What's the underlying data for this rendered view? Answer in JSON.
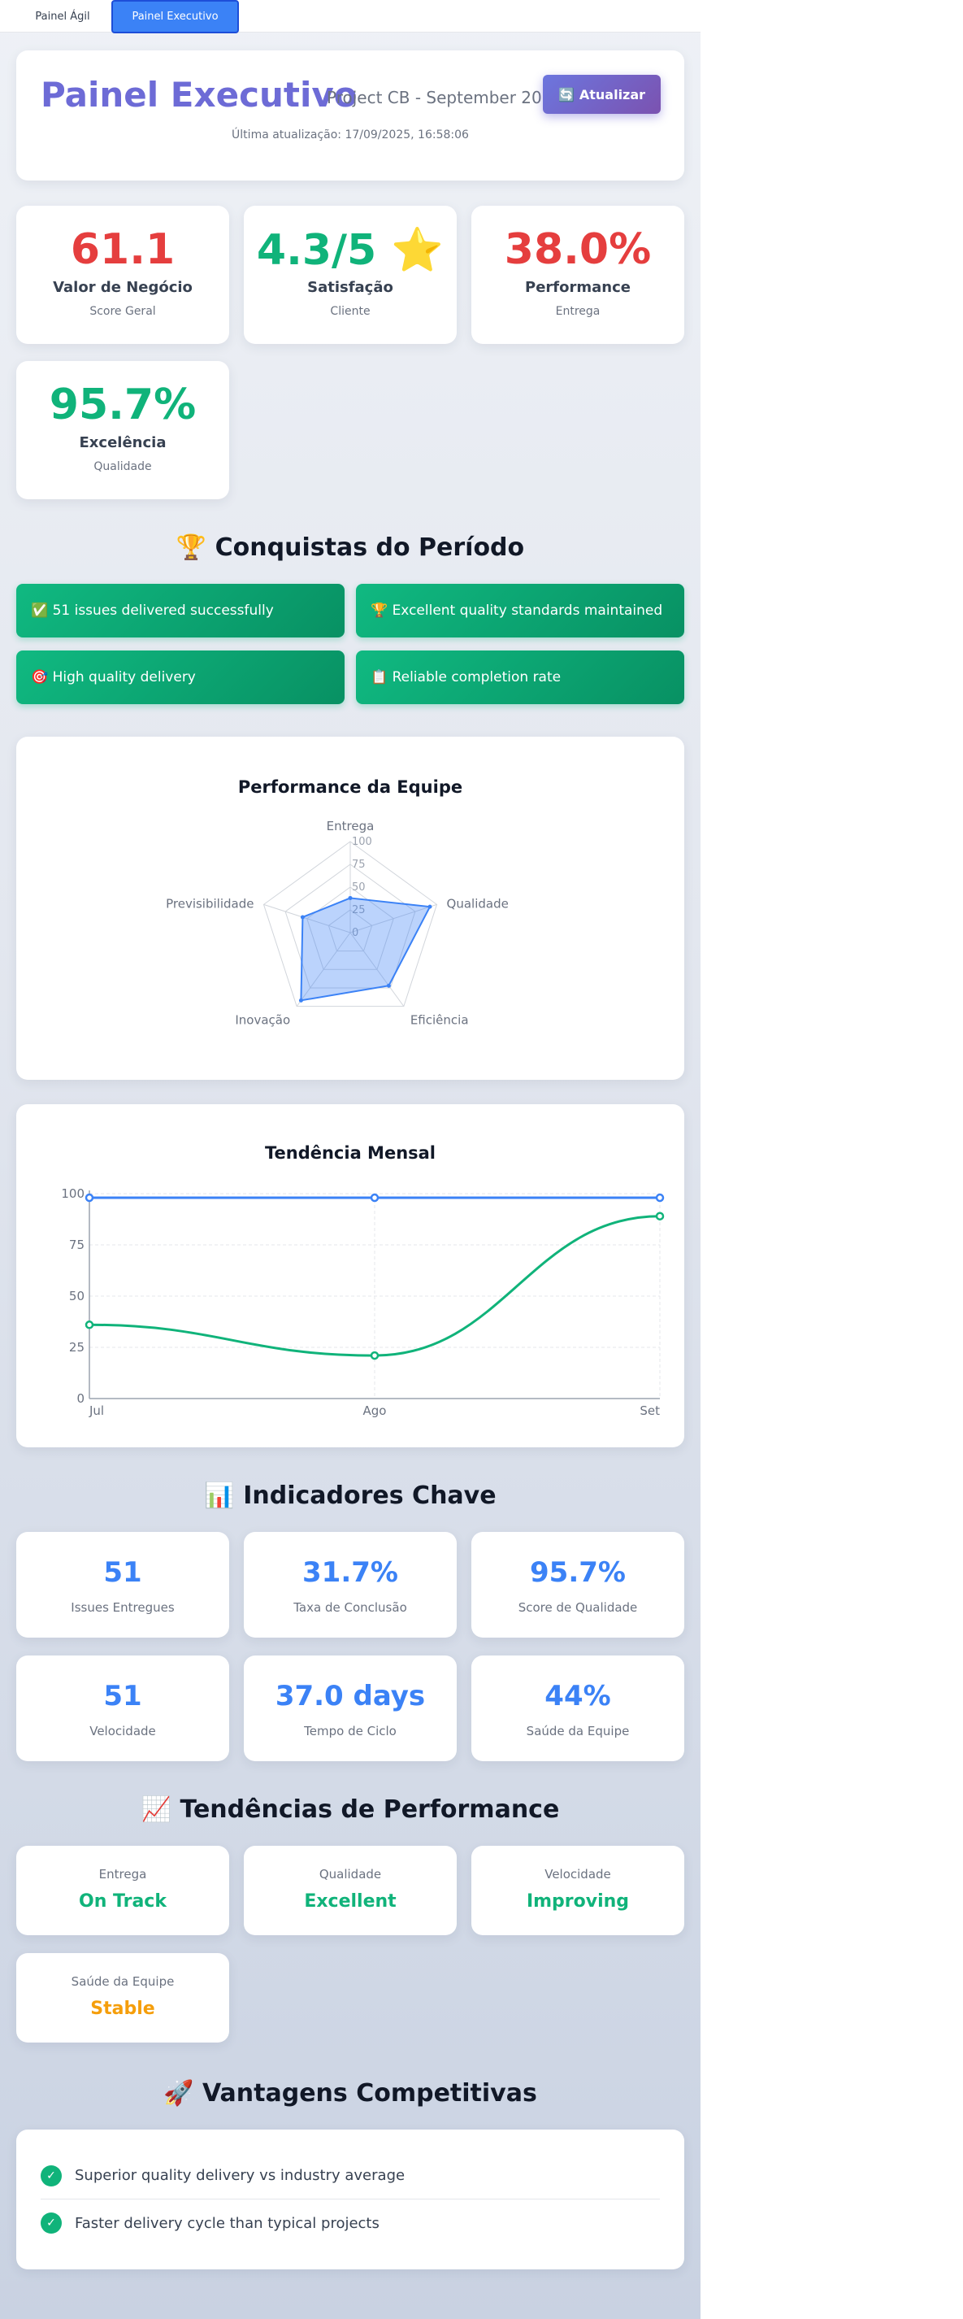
{
  "tabs": [
    {
      "label": "Painel Ágil"
    },
    {
      "label": "Painel Executivo"
    }
  ],
  "header": {
    "title": "Painel Executivo",
    "subtitle": "Project CB - September 2025",
    "refresh_icon": "🔄",
    "refresh_label": "Atualizar",
    "updated": "Última atualização: 17/09/2025, 16:58:06"
  },
  "kpis": [
    {
      "value": "61.1",
      "label": "Valor de Negócio",
      "sub": "Score Geral",
      "color": "#e53e3e"
    },
    {
      "value": "4.3/5 ⭐",
      "label": "Satisfação",
      "sub": "Cliente",
      "color": "#10b37a"
    },
    {
      "value": "38.0%",
      "label": "Performance",
      "sub": "Entrega",
      "color": "#e53e3e"
    },
    {
      "value": "95.7%",
      "label": "Excelência",
      "sub": "Qualidade",
      "color": "#10b37a"
    }
  ],
  "achievements": {
    "title": "🏆 Conquistas do Período",
    "items": [
      "✅ 51 issues delivered successfully",
      "🏆 Excellent quality standards maintained",
      "🎯 High quality delivery",
      "📋 Reliable completion rate"
    ]
  },
  "radar": {
    "title": "Performance da Equipe",
    "axes": [
      "Entrega",
      "Qualidade",
      "Eficiência",
      "Inovação",
      "Previsibilidade"
    ],
    "ticks": [
      "0",
      "25",
      "50",
      "75",
      "100"
    ]
  },
  "trend_chart": {
    "title": "Tendência Mensal",
    "x_labels": [
      "Jul",
      "Ago",
      "Set"
    ],
    "y_ticks": [
      "0",
      "25",
      "50",
      "75",
      "100"
    ]
  },
  "chart_data": [
    {
      "type": "radar",
      "title": "Performance da Equipe",
      "categories": [
        "Entrega",
        "Qualidade",
        "Eficiência",
        "Inovação",
        "Previsibilidade"
      ],
      "values": [
        38,
        92,
        72,
        92,
        55
      ],
      "ylim": [
        0,
        100
      ]
    },
    {
      "type": "line",
      "title": "Tendência Mensal",
      "categories": [
        "Jul",
        "Ago",
        "Set"
      ],
      "series": [
        {
          "values": [
            98,
            98,
            98
          ],
          "color": "#3b82f6"
        },
        {
          "values": [
            36,
            21,
            89
          ],
          "color": "#10b37a"
        }
      ],
      "ylim": [
        0,
        100
      ],
      "grid": true
    }
  ],
  "indicators": {
    "title": "📊 Indicadores Chave",
    "items": [
      {
        "value": "51",
        "label": "Issues Entregues"
      },
      {
        "value": "31.7%",
        "label": "Taxa de Conclusão"
      },
      {
        "value": "95.7%",
        "label": "Score de Qualidade"
      },
      {
        "value": "51",
        "label": "Velocidade"
      },
      {
        "value": "37.0 days",
        "label": "Tempo de Ciclo"
      },
      {
        "value": "44%",
        "label": "Saúde da Equipe"
      }
    ]
  },
  "trends": {
    "title": "📈 Tendências de Performance",
    "items": [
      {
        "label": "Entrega",
        "value": "On Track",
        "color": "#10b37a"
      },
      {
        "label": "Qualidade",
        "value": "Excellent",
        "color": "#10b37a"
      },
      {
        "label": "Velocidade",
        "value": "Improving",
        "color": "#10b37a"
      },
      {
        "label": "Saúde da Equipe",
        "value": "Stable",
        "color": "#f59e0b"
      }
    ]
  },
  "advantages": {
    "title": "🚀 Vantagens Competitivas",
    "check": "✓",
    "items": [
      "Superior quality delivery vs industry average",
      "Faster delivery cycle than typical projects"
    ]
  }
}
